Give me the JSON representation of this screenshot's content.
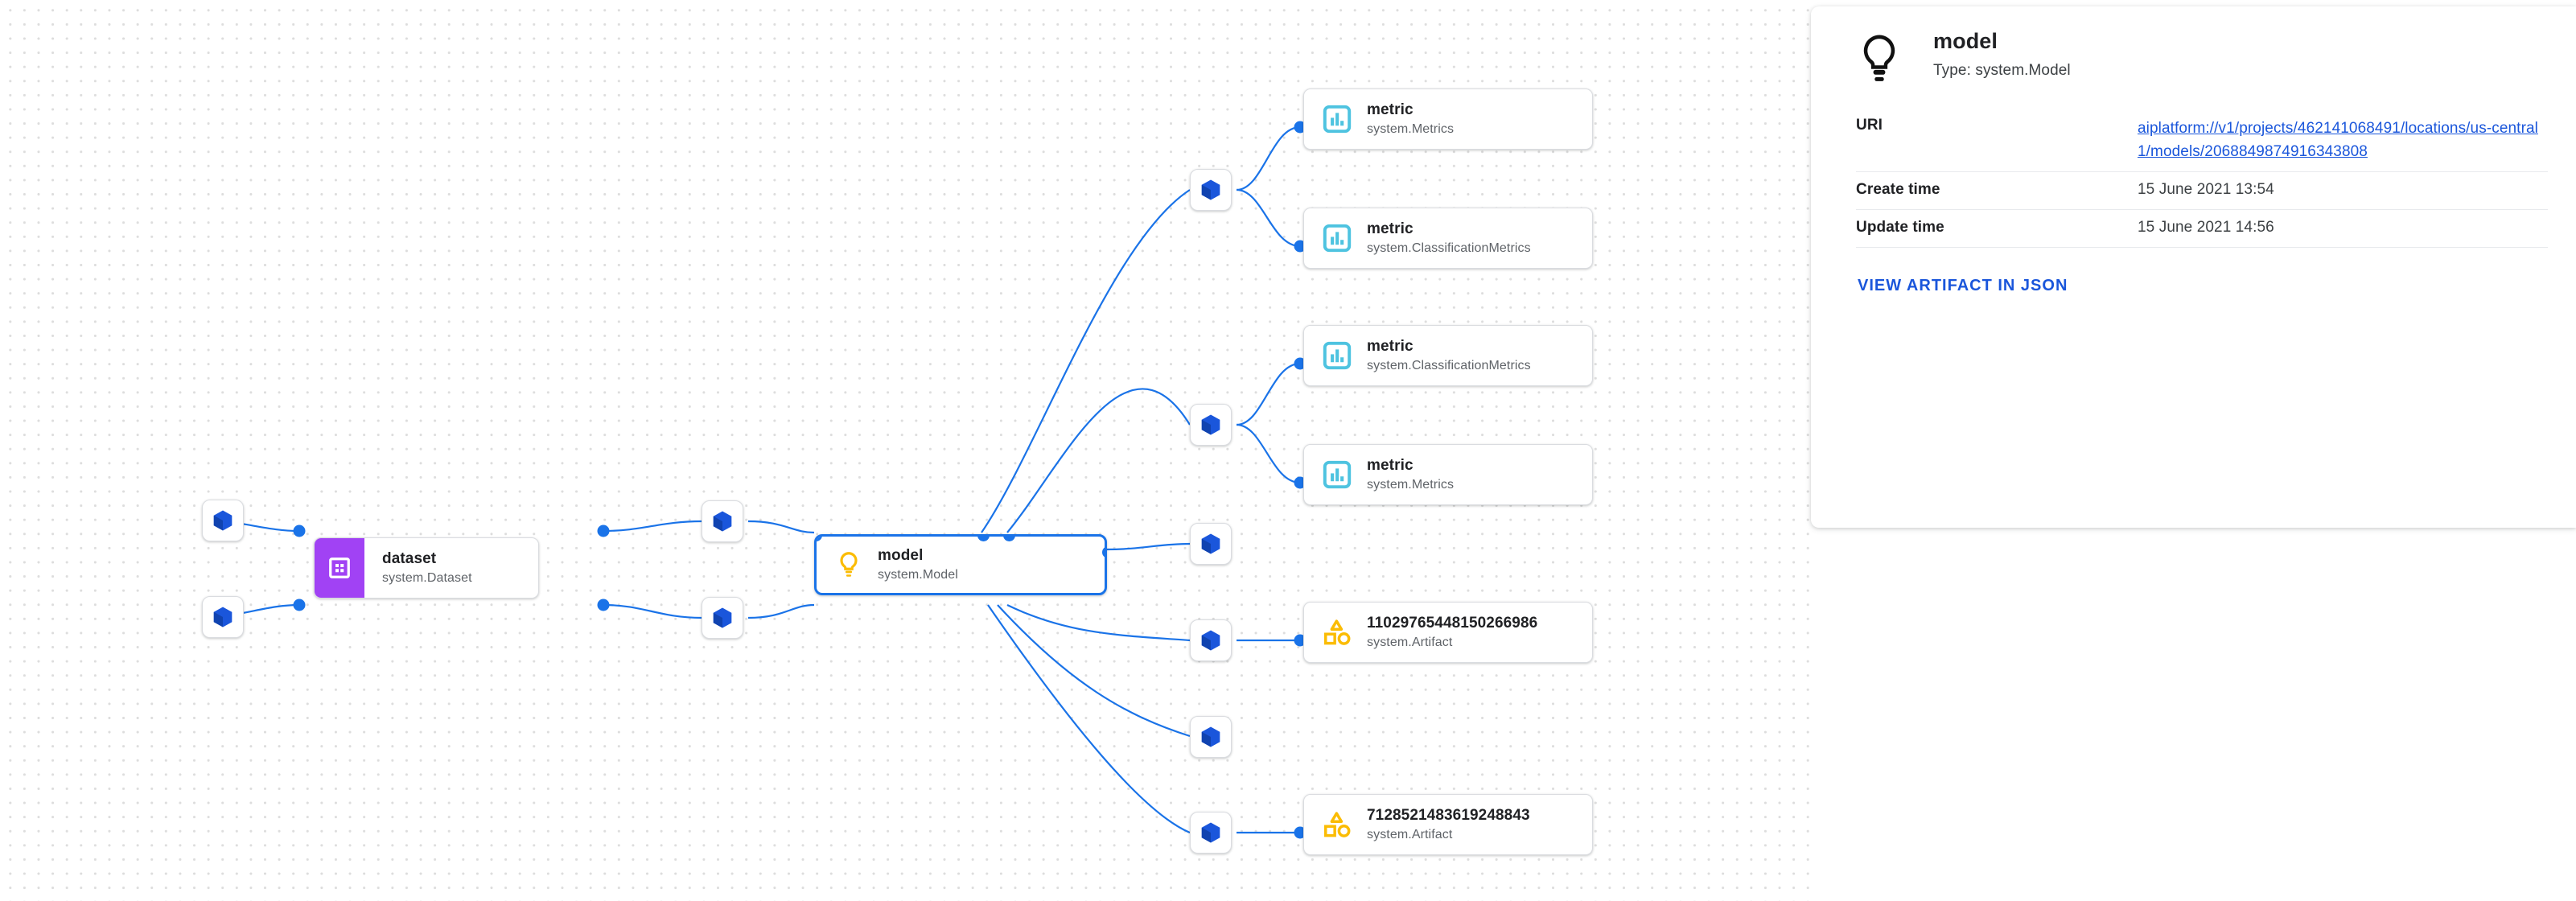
{
  "panel": {
    "icon": "lightbulb-icon",
    "title": "model",
    "type_line": "Type: system.Model",
    "rows": [
      {
        "key": "URI",
        "value": "aiplatform://v1/projects/462141068491/locations/us-central1/models/2068849874916343808",
        "is_link": true
      },
      {
        "key": "Create time",
        "value": "15 June 2021 13:54",
        "is_link": false
      },
      {
        "key": "Update time",
        "value": "15 June 2021 14:56",
        "is_link": false
      }
    ],
    "action_label": "VIEW ARTIFACT IN JSON"
  },
  "graph": {
    "colors": {
      "edge": "#1a73e8",
      "port": "#1a73e8",
      "selected_border": "#1a73e8",
      "cube": "#1a56db",
      "metric": "#4ec3e0",
      "artifact": "#fbbc04",
      "dataset": "#a142f4",
      "model_bulb": "#fbbc04"
    },
    "nodes": [
      {
        "id": "cube-in-1",
        "kind": "execution-cube",
        "icon": "cube-icon"
      },
      {
        "id": "cube-in-2",
        "kind": "execution-cube",
        "icon": "cube-icon"
      },
      {
        "id": "dataset",
        "kind": "dataset",
        "icon": "table-grid-icon",
        "title": "dataset",
        "subtitle": "system.Dataset"
      },
      {
        "id": "cube-mid-1",
        "kind": "execution-cube",
        "icon": "cube-icon"
      },
      {
        "id": "cube-mid-2",
        "kind": "execution-cube",
        "icon": "cube-icon"
      },
      {
        "id": "model",
        "kind": "model",
        "icon": "lightbulb-icon",
        "title": "model",
        "subtitle": "system.Model",
        "selected": true
      },
      {
        "id": "cube-out-1",
        "kind": "execution-cube",
        "icon": "cube-icon"
      },
      {
        "id": "cube-out-2",
        "kind": "execution-cube",
        "icon": "cube-icon"
      },
      {
        "id": "cube-out-3",
        "kind": "execution-cube",
        "icon": "cube-icon"
      },
      {
        "id": "cube-out-4",
        "kind": "execution-cube",
        "icon": "cube-icon"
      },
      {
        "id": "cube-out-5",
        "kind": "execution-cube",
        "icon": "cube-icon"
      },
      {
        "id": "metric-1",
        "kind": "metric",
        "icon": "bar-chart-icon",
        "title": "metric",
        "subtitle": "system.Metrics"
      },
      {
        "id": "metric-2",
        "kind": "metric",
        "icon": "bar-chart-icon",
        "title": "metric",
        "subtitle": "system.ClassificationMetrics"
      },
      {
        "id": "metric-3",
        "kind": "metric",
        "icon": "bar-chart-icon",
        "title": "metric",
        "subtitle": "system.ClassificationMetrics"
      },
      {
        "id": "metric-4",
        "kind": "metric",
        "icon": "bar-chart-icon",
        "title": "metric",
        "subtitle": "system.Metrics"
      },
      {
        "id": "artifact-1",
        "kind": "artifact",
        "icon": "shapes-icon",
        "title": "11029765448150266986",
        "subtitle": "system.Artifact"
      },
      {
        "id": "artifact-2",
        "kind": "artifact",
        "icon": "shapes-icon",
        "title": "7128521483619248843",
        "subtitle": "system.Artifact"
      }
    ]
  }
}
